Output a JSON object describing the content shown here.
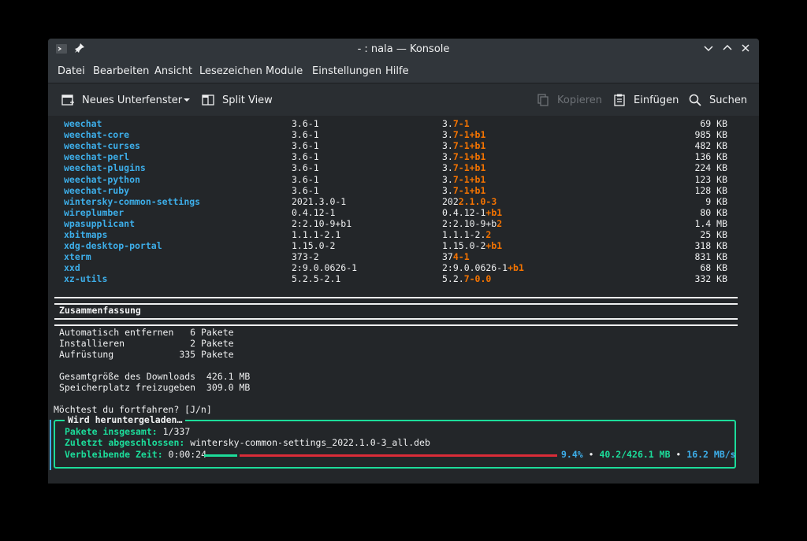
{
  "window": {
    "title": "- : nala — Konsole"
  },
  "menubar": [
    "Datei",
    "Bearbeiten",
    "Ansicht",
    "Lesezeichen",
    "Module",
    "Einstellungen",
    "Hilfe"
  ],
  "toolbar": {
    "new_tab": "Neues Unterfenster",
    "split_view": "Split View",
    "copy": "Kopieren",
    "paste": "Einfügen",
    "search": "Suchen"
  },
  "packages": [
    {
      "name": "weechat",
      "old": "3.6-1",
      "new_base": "3.",
      "new_change": "7-1",
      "size": "69 KB"
    },
    {
      "name": "weechat-core",
      "old": "3.6-1",
      "new_base": "3.",
      "new_change": "7-1+b1",
      "size": "985 KB"
    },
    {
      "name": "weechat-curses",
      "old": "3.6-1",
      "new_base": "3.",
      "new_change": "7-1+b1",
      "size": "482 KB"
    },
    {
      "name": "weechat-perl",
      "old": "3.6-1",
      "new_base": "3.",
      "new_change": "7-1+b1",
      "size": "136 KB"
    },
    {
      "name": "weechat-plugins",
      "old": "3.6-1",
      "new_base": "3.",
      "new_change": "7-1+b1",
      "size": "224 KB"
    },
    {
      "name": "weechat-python",
      "old": "3.6-1",
      "new_base": "3.",
      "new_change": "7-1+b1",
      "size": "123 KB"
    },
    {
      "name": "weechat-ruby",
      "old": "3.6-1",
      "new_base": "3.",
      "new_change": "7-1+b1",
      "size": "128 KB"
    },
    {
      "name": "wintersky-common-settings",
      "old": "2021.3.0-1",
      "new_base": "202",
      "new_change": "2.1.0-3",
      "size": "9 KB"
    },
    {
      "name": "wireplumber",
      "old": "0.4.12-1",
      "new_base": "0.4.12-1",
      "new_change": "+b1",
      "size": "80 KB"
    },
    {
      "name": "wpasupplicant",
      "old": "2:2.10-9+b1",
      "new_base": "2:2.10-9+b",
      "new_change": "2",
      "size": "1.4 MB"
    },
    {
      "name": "xbitmaps",
      "old": "1.1.1-2.1",
      "new_base": "1.1.1-2.",
      "new_change": "2",
      "size": "25 KB"
    },
    {
      "name": "xdg-desktop-portal",
      "old": "1.15.0-2",
      "new_base": "1.15.0-2",
      "new_change": "+b1",
      "size": "318 KB"
    },
    {
      "name": "xterm",
      "old": "373-2",
      "new_base": "37",
      "new_change": "4-1",
      "size": "831 KB"
    },
    {
      "name": "xxd",
      "old": "2:9.0.0626-1",
      "new_base": "2:9.0.0626-1",
      "new_change": "+b1",
      "size": "68 KB"
    },
    {
      "name": "xz-utils",
      "old": "5.2.5-2.1",
      "new_base": "5.2.",
      "new_change": "7-0.0",
      "size": "332 KB"
    }
  ],
  "summary": {
    "heading": "Zusammenfassung",
    "auto_remove": "Automatisch entfernen   6 Pakete",
    "install": "Installieren            2 Pakete",
    "upgrade": "Aufrüstung            335 Pakete",
    "download_size": "Gesamtgröße des Downloads  426.1 MB",
    "disk_space": "Speicherplatz freizugeben  309.0 MB"
  },
  "prompt": "Möchtest du fortfahren? [J/n]",
  "progress": {
    "title": "Wird heruntergeladen…",
    "packages_label": "Pakete insgesamt:",
    "packages_value": " 1/337",
    "last_label": "Zuletzt abgeschlossen:",
    "last_value": " wintersky-common-settings_2022.1.0-3_all.deb",
    "remaining_label": "Verbleibende Zeit:",
    "remaining_value": " 0:00:24",
    "percent": "9.4%",
    "sep1": " • ",
    "downloaded": "40.2/426.1 MB",
    "sep2": " • ",
    "speed": "16.2 MB/s",
    "fraction": 0.094
  },
  "colors": {
    "package_name": "#3daee9",
    "version_change": "#f67400",
    "progress_border": "#1cdc9a",
    "progress_done": "#1cdc9a",
    "progress_rest": "#da2c38"
  }
}
